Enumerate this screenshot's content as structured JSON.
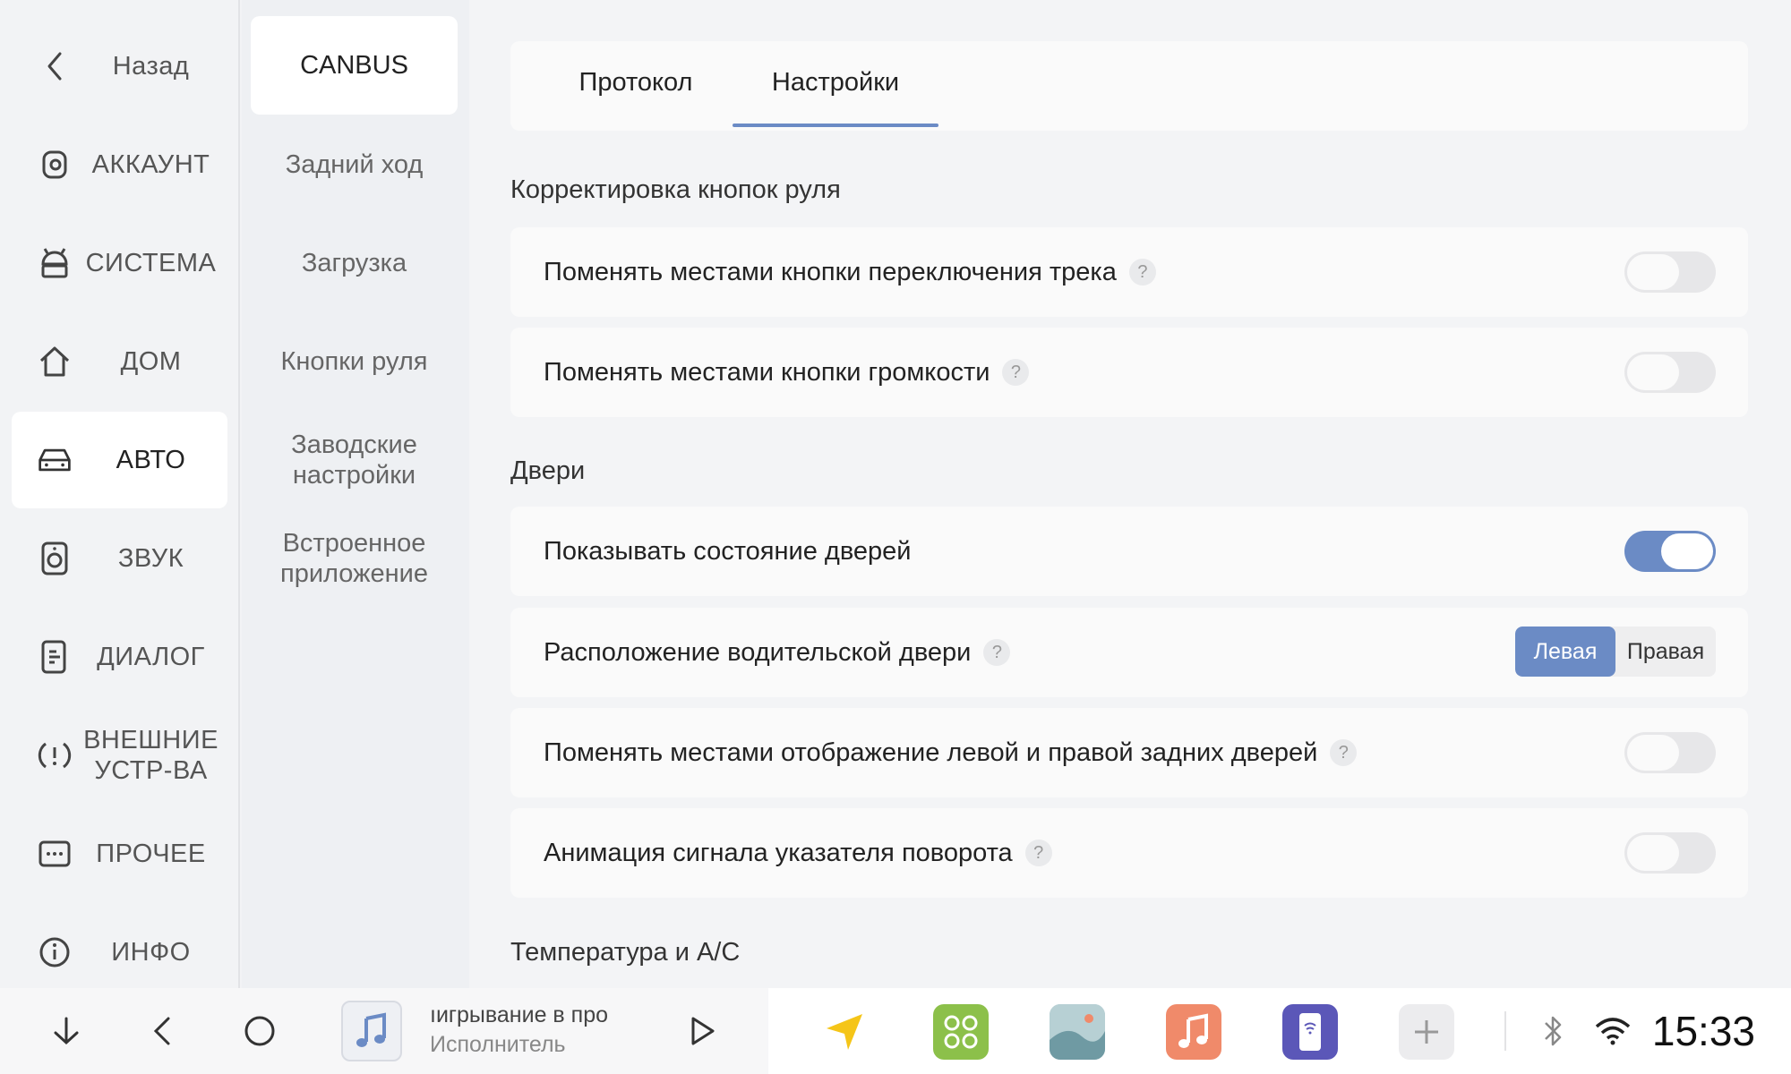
{
  "sidebar": {
    "items": [
      {
        "label": "Назад",
        "icon": "chevron-left-icon"
      },
      {
        "label": "АККАУНТ",
        "icon": "account-icon"
      },
      {
        "label": "СИСТЕМА",
        "icon": "android-icon"
      },
      {
        "label": "ДОМ",
        "icon": "home-icon"
      },
      {
        "label": "АВТО",
        "icon": "car-icon",
        "active": true
      },
      {
        "label": "ЗВУК",
        "icon": "speaker-icon"
      },
      {
        "label": "ДИАЛОГ",
        "icon": "voice-icon"
      },
      {
        "label": "ВНЕШНИЕ УСТР-ВА",
        "icon": "external-devices-icon"
      },
      {
        "label": "ПРОЧЕЕ",
        "icon": "more-icon"
      },
      {
        "label": "ИНФО",
        "icon": "info-icon"
      }
    ]
  },
  "submenu": {
    "items": [
      {
        "label": "CANBUS",
        "active": true
      },
      {
        "label": "Задний ход"
      },
      {
        "label": "Загрузка"
      },
      {
        "label": "Кнопки руля"
      },
      {
        "label": "Заводские настройки"
      },
      {
        "label": "Встроенное приложение"
      }
    ]
  },
  "tabs": [
    {
      "label": "Протокол"
    },
    {
      "label": "Настройки",
      "active": true
    }
  ],
  "sections": [
    {
      "title": "Корректировка кнопок руля",
      "rows": [
        {
          "label": "Поменять местами кнопки переключения трека",
          "help": "?",
          "toggle": false
        },
        {
          "label": "Поменять местами кнопки громкости",
          "help": "?",
          "toggle": false
        }
      ]
    },
    {
      "title": "Двери",
      "rows": [
        {
          "label": "Показывать состояние дверей",
          "toggle": true
        },
        {
          "label": "Расположение водительской двери",
          "help": "?",
          "segment": [
            "Левая",
            "Правая"
          ],
          "selected": "Левая"
        },
        {
          "label": "Поменять местами отображение левой и правой задних дверей",
          "help": "?",
          "toggle": false
        },
        {
          "label": "Анимация сигнала указателя поворота",
          "help": "?",
          "toggle": false
        }
      ]
    },
    {
      "title": "Температура и A/C"
    }
  ],
  "bottombar": {
    "media_title": "ıигрывание в про",
    "media_artist": "Исполнитель",
    "clock": "15:33",
    "colors": {
      "accent": "#6b8bc5",
      "nav": "#f5c518",
      "apps": "#8cc04a",
      "gallery": "#7aa6b0",
      "music": "#f08a6a",
      "phone": "#5b57b8"
    }
  }
}
